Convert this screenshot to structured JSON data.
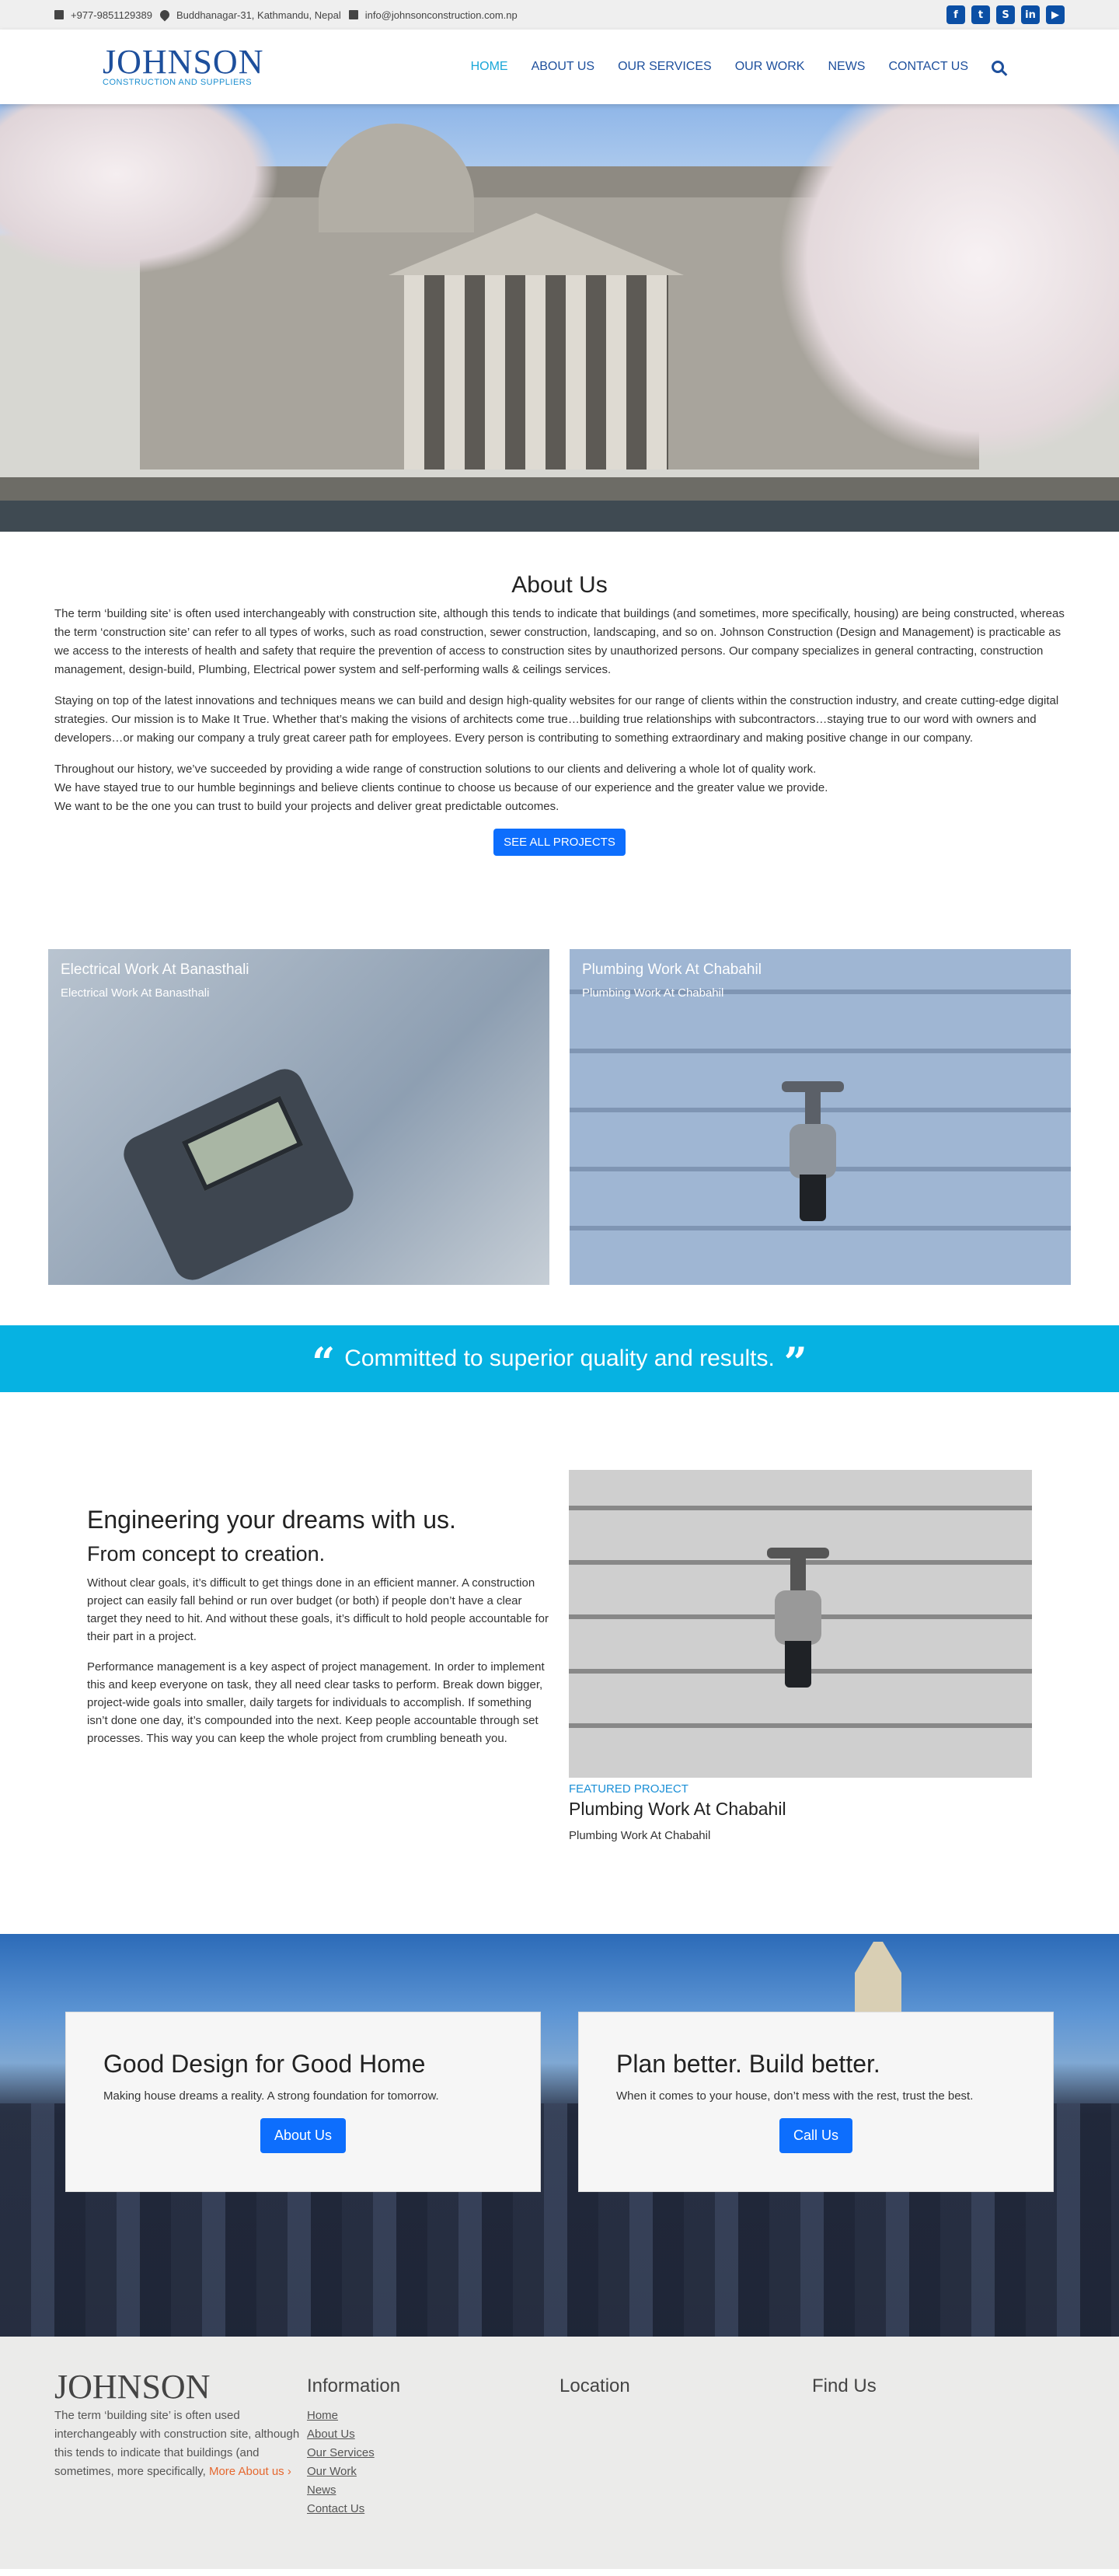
{
  "topbar": {
    "phone": "+977-9851129389",
    "address": "Buddhanagar-31, Kathmandu, Nepal",
    "email": "info@johnsonconstruction.com.np",
    "socials": [
      "facebook-icon",
      "twitter-icon",
      "skype-icon",
      "linkedin-icon",
      "youtube-icon"
    ]
  },
  "header": {
    "logo_name": "JOHNSON",
    "logo_tag": "CONSTRUCTION AND SUPPLIERS",
    "nav": [
      "HOME",
      "ABOUT US",
      "OUR SERVICES",
      "OUR WORK",
      "NEWS",
      "CONTACT US"
    ]
  },
  "about": {
    "title": "About Us",
    "p1": "The term ‘building site’ is often used interchangeably with construction site, although this tends to indicate that buildings (and sometimes, more specifically, housing) are being constructed, whereas the term ‘construction site’ can refer to all types of works, such as road construction, sewer construction, landscaping, and so on. Johnson Construction (Design and Management) is practicable as we access to the interests of health and safety that require the prevention of access to construction sites by unauthorized persons. Our company specializes in general contracting, construction management, design-build, Plumbing, Electrical power system and self-performing walls & ceilings services.",
    "p2": "Staying on top of the latest innovations and techniques means we can build and design high-quality websites for our range of clients within the construction industry, and create cutting-edge digital strategies. Our mission is to Make It True. Whether that’s making the visions of architects come true…building true relationships with subcontractors…staying true to our word with owners and developers…or making our company a truly great career path for employees. Every person is contributing to something extraordinary and making positive change in our company.",
    "p3": "Throughout our history, we’ve succeeded by providing a wide range of construction solutions to our clients and delivering a whole lot of quality work.",
    "p4": "We have stayed true to our humble beginnings and believe clients continue to choose us because of our experience and the greater value we provide.",
    "p5": "We want to be the one you can trust to build your projects and deliver great predictable outcomes.",
    "button": "SEE ALL PROJECTS"
  },
  "projects": [
    {
      "title": "Electrical Work At Banasthali",
      "subtitle": "Electrical Work At Banasthali"
    },
    {
      "title": "Plumbing Work At Chabahil",
      "subtitle": "Plumbing Work At Chabahil"
    }
  ],
  "quote": "Committed to superior quality and results.",
  "engineering": {
    "title": "Engineering your dreams with us.",
    "subtitle": "From concept to creation.",
    "p1": "Without clear goals, it’s difficult to get things done in an efficient manner. A construction project can easily fall behind or run over budget (or both) if people don’t have a clear target they need to hit. And without these goals, it’s difficult to hold people accountable for their part in a project.",
    "p2": "Performance management is a key aspect of project management. In order to implement this and keep everyone on task, they all need clear tasks to perform. Break down bigger, project-wide goals into smaller, daily targets for individuals to accomplish. If something isn’t done one day, it’s compounded into the next. Keep people accountable through set processes. This way you can keep the whole project from crumbling beneath you.",
    "featured_tag": "FEATURED PROJECT",
    "featured_title": "Plumbing Work At Chabahil",
    "featured_sub": "Plumbing Work At Chabahil"
  },
  "cards": [
    {
      "title": "Good Design for Good Home",
      "text": "Making house dreams a reality. A strong foundation for tomorrow.",
      "button": "About Us"
    },
    {
      "title": "Plan better. Build better.",
      "text": "When it comes to your house, don’t mess with the rest, trust the best.",
      "button": "Call Us"
    }
  ],
  "footer": {
    "logo": "JOHNSON",
    "text": "The term ‘building site’ is often used interchangeably with construction site, although this tends to indicate that buildings (and sometimes, more specifically,",
    "more_link": "More About us",
    "info_title": "Information",
    "links": [
      "Home",
      "About Us",
      "Our Services",
      "Our Work",
      "News",
      "Contact Us"
    ],
    "location_title": "Location",
    "find_title": "Find Us"
  }
}
